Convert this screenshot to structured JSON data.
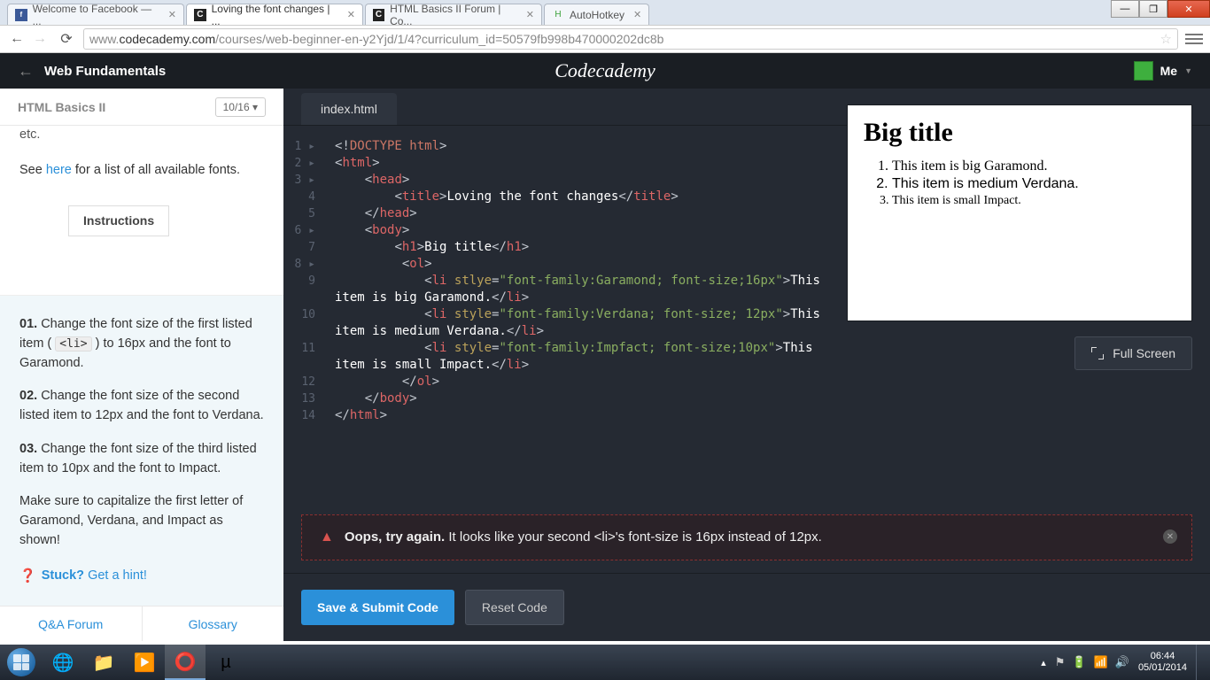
{
  "window": {
    "minimize": "—",
    "maximize": "❐",
    "close": "✕"
  },
  "tabs": [
    {
      "favicon": "fb",
      "favtext": "f",
      "title": "Welcome to Facebook — ..."
    },
    {
      "favicon": "cc",
      "favtext": "C",
      "title": "Loving the font changes | ...",
      "active": true
    },
    {
      "favicon": "cc",
      "favtext": "C",
      "title": "HTML Basics II Forum | Co..."
    },
    {
      "favicon": "ahk",
      "favtext": "H",
      "title": "AutoHotkey"
    }
  ],
  "urlbar": {
    "prefix": "www.",
    "host": "codecademy.com",
    "path": "/courses/web-beginner-en-y2Yjd/1/4?curriculum_id=50579fb998b470000202dc8b"
  },
  "cc_header": {
    "course": "Web Fundamentals",
    "logo": "Codecademy",
    "me": "Me"
  },
  "sidebar": {
    "title": "HTML Basics II",
    "progress": "10/16 ▾",
    "etc": "etc.",
    "see_pre": "See ",
    "see_link": "here",
    "see_post": " for a list of all available fonts.",
    "instructions_label": "Instructions",
    "ins": [
      {
        "num": "01.",
        "text": " Change the font size of the first listed item ( ",
        "code": "<li>",
        "text2": " ) to 16px and the font to Garamond."
      },
      {
        "num": "02.",
        "text": " Change the font size of the second listed item to 12px and the font to Verdana."
      },
      {
        "num": "03.",
        "text": " Change the font size of the third listed item to 10px and the font to Impact."
      }
    ],
    "note": "Make sure to capitalize the first letter of Garamond, Verdana, and Impact as shown!",
    "stuck": "Stuck?",
    "hint": "Get a hint!",
    "qa": "Q&A Forum",
    "glossary": "Glossary"
  },
  "editor": {
    "filename": "index.html",
    "lines": [
      "1 ▸",
      "2 ▸",
      "3 ▸",
      "4",
      "5",
      "6 ▸",
      "7",
      "8 ▸",
      "9",
      "",
      "10",
      "",
      "11",
      "",
      "12",
      "13",
      "14"
    ]
  },
  "code": {
    "l1": "<!DOCTYPE html>",
    "l4_text": "Loving the font changes",
    "l7_text": "Big title",
    "l9_attr": "stlye",
    "l9_val": "\"font-family:Garamond; font-size;16px\"",
    "l9_txt1": "This",
    "l9_txt2": "item is big Garamond.",
    "l10_attr": "style",
    "l10_val": "\"font-family:Verdana; font-size; 12px\"",
    "l10_txt1": "This",
    "l10_txt2": "item is medium Verdana.",
    "l11_attr": "style",
    "l11_val": "\"font-family:Impfact; font-size;10px\"",
    "l11_txt1": "This",
    "l11_txt2": "item is small Impact."
  },
  "preview": {
    "title": "Big title",
    "items": [
      "This item is big Garamond.",
      "This item is medium Verdana.",
      "This item is small Impact."
    ]
  },
  "fullscreen": "Full Screen",
  "error": {
    "lead": "Oops, try again.",
    "msg": " It looks like your second <li>'s font-size is 16px instead of 12px."
  },
  "actions": {
    "submit": "Save & Submit Code",
    "reset": "Reset Code"
  },
  "taskbar": {
    "time": "06:44",
    "date": "05/01/2014"
  }
}
